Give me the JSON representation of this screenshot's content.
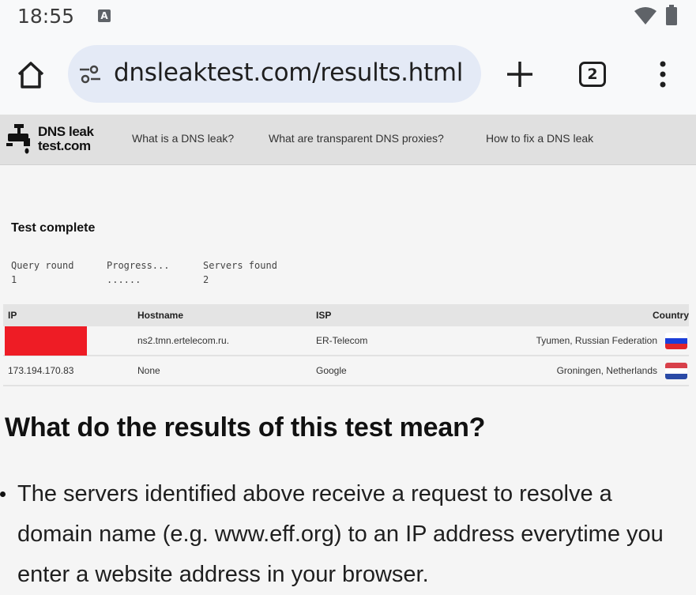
{
  "status_bar": {
    "time": "18:55",
    "notification_icon": "A"
  },
  "toolbar": {
    "url": "dnsleaktest.com/results.html",
    "tab_count": "2",
    "icons": [
      "home-icon",
      "site-settings-icon",
      "plus-icon",
      "tabs-icon",
      "more-vert-icon"
    ]
  },
  "site": {
    "logo_line1": "DNS leak",
    "logo_line2": "test.com",
    "nav": [
      "What is a DNS leak?",
      "What are transparent DNS proxies?",
      "How to fix a DNS leak"
    ]
  },
  "test": {
    "status": "Test complete",
    "stats": [
      {
        "label": "Query round",
        "value": "1"
      },
      {
        "label": "Progress...",
        "value": "......"
      },
      {
        "label": "Servers found",
        "value": "2"
      }
    ]
  },
  "results": {
    "headers": {
      "ip": "IP",
      "hostname": "Hostname",
      "isp": "ISP",
      "country": "Country"
    },
    "rows": [
      {
        "ip": "",
        "hostname": "ns2.tmn.ertelecom.ru.",
        "isp": "ER-Telecom",
        "country": "Tyumen, Russian Federation",
        "flag": [
          "#ffffff",
          "#1c3fd8",
          "#e3262a"
        ]
      },
      {
        "ip": "173.194.170.83",
        "hostname": "None",
        "isp": "Google",
        "country": "Groningen, Netherlands",
        "flag": [
          "#d8404a",
          "#ffffff",
          "#2a4aa6"
        ]
      }
    ]
  },
  "explanation": {
    "title": "What do the results of this test mean?",
    "bullet": "The servers identified above receive a request to resolve a domain name (e.g. www.eff.org) to an IP address everytime you enter a website address in your browser."
  }
}
